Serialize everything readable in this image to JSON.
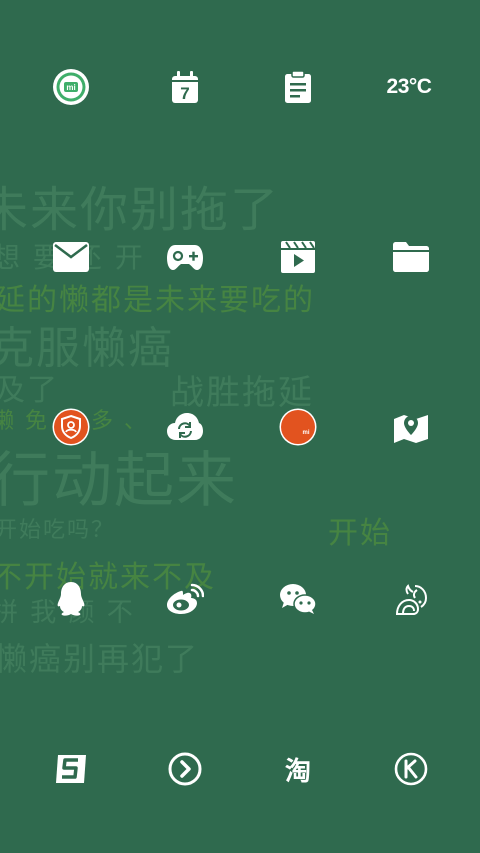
{
  "status": {
    "temperature": "23°C"
  },
  "calendar": {
    "day": "7"
  },
  "wallpaper": {
    "lines": [
      "未来你别拖了",
      "想  要  还  开",
      "延的懒都是未来要吃的",
      "克服懒癌",
      "及了",
      "战胜拖延",
      "懒  免  哥  多  、",
      "行动起来",
      "开始吃吗？",
      "开始",
      "不开始就来不及",
      "拼  我  颜  不",
      "懒癌别再犯了"
    ]
  },
  "dock": {
    "taobao_glyph": "淘"
  },
  "colors": {
    "background": "#2f6a4e",
    "accent_orange": "#e2531f",
    "icon_white": "#ffffff"
  },
  "icons": [
    "mi-community-icon",
    "calendar-icon",
    "notes-icon",
    "weather-widget",
    "mail-icon",
    "game-center-icon",
    "video-player-icon",
    "file-manager-icon",
    "security-shield-icon",
    "cloud-sync-icon",
    "mi-store-icon",
    "maps-icon",
    "qq-icon",
    "weibo-icon",
    "wechat-icon",
    "uc-browser-icon",
    "sogou-input-icon",
    "play-circle-icon",
    "taobao-icon",
    "kugou-icon"
  ]
}
